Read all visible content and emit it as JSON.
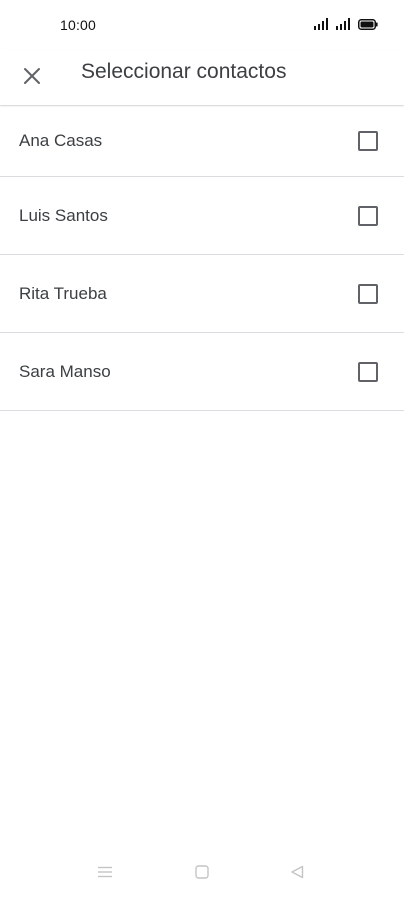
{
  "status_bar": {
    "time": "10:00"
  },
  "app_bar": {
    "title": "Seleccionar contactos",
    "close_icon": "close-icon"
  },
  "contacts": [
    {
      "name": "Ana Casas",
      "checked": false
    },
    {
      "name": "Luis Santos",
      "checked": false
    },
    {
      "name": "Rita Trueba",
      "checked": false
    },
    {
      "name": "Sara Manso",
      "checked": false
    }
  ],
  "nav_bar": {
    "icons": [
      "menu-icon",
      "home-icon",
      "back-icon"
    ]
  },
  "colors": {
    "text_primary": "#3c4043",
    "divider": "#dadce0",
    "checkbox_border": "#5f6368",
    "nav_icon": "#c4c4c4"
  }
}
